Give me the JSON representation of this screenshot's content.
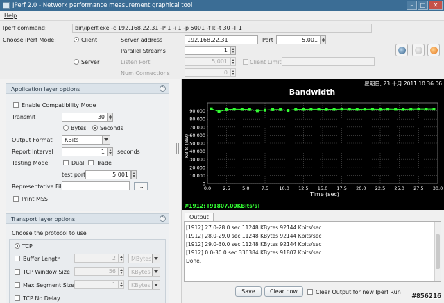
{
  "window": {
    "title": "JPerf 2.0 - Network performance measurement graphical tool"
  },
  "menu": {
    "help": "Help"
  },
  "command": {
    "label": "Iperf command:",
    "value": "bin/iperf.exe -c 192.168.22.31 -P 1 -i 1 -p 5001 -f k -t 30 -T 1"
  },
  "mode": {
    "label": "Choose iPerf Mode:",
    "client_label": "Client",
    "server_label": "Server",
    "server_address_label": "Server address",
    "server_address_value": "192.168.22.31",
    "port_label": "Port",
    "port_value": "5,001",
    "parallel_label": "Parallel Streams",
    "parallel_value": "1",
    "listen_port_label": "Listen Port",
    "listen_port_value": "5,001",
    "client_limit_label": "Client Limit",
    "num_conn_label": "Num Connections",
    "num_conn_value": "0"
  },
  "app_options": {
    "title": "Application layer options",
    "compat_label": "Enable Compatibility Mode",
    "transmit_label": "Transmit",
    "transmit_value": "30",
    "bytes_label": "Bytes",
    "seconds_label": "Seconds",
    "output_format_label": "Output Format",
    "output_format_value": "KBits",
    "report_interval_label": "Report Interval",
    "report_interval_value": "1",
    "seconds_unit": "seconds",
    "testing_mode_label": "Testing Mode",
    "dual_label": "Dual",
    "trade_label": "Trade",
    "test_port_label": "test port",
    "test_port_value": "5,001",
    "rep_file_label": "Representative File",
    "browse_label": "...",
    "print_mss_label": "Print MSS"
  },
  "transport": {
    "title": "Transport layer options",
    "choose_label": "Choose the protocol to use",
    "tcp_label": "TCP",
    "buffer_label": "Buffer Length",
    "buffer_value": "2",
    "buffer_unit": "MBytes",
    "window_label": "TCP Window Size",
    "window_value": "56",
    "window_unit": "KBytes",
    "mss_label": "Max Segment Size",
    "mss_value": "1",
    "mss_unit": "KBytes",
    "nodelay_label": "TCP No Delay"
  },
  "chart_data": {
    "type": "line",
    "title": "Bandwidth",
    "timestamp": "星期日, 23 十月 2011 10:36:06",
    "xlabel": "Time (sec)",
    "ylabel": "KBits (BW)",
    "xlim": [
      0,
      30
    ],
    "ylim": [
      0,
      100000
    ],
    "x_ticks": [
      "0.0",
      "2.5",
      "5.0",
      "7.5",
      "10.0",
      "12.5",
      "15.0",
      "17.5",
      "20.0",
      "22.5",
      "25.0",
      "27.5",
      "30.0"
    ],
    "y_ticks": [
      "0",
      "10,000",
      "20,000",
      "30,000",
      "40,000",
      "50,000",
      "60,000",
      "70,000",
      "80,000",
      "90,000"
    ],
    "grid": true,
    "series": [
      {
        "name": "#1912: [91807.00KBits/s]",
        "color": "#33ff33",
        "x": [
          0.5,
          1.5,
          2.5,
          3.5,
          4.5,
          5.5,
          6.5,
          7.5,
          8.5,
          9.5,
          10.5,
          11.5,
          12.5,
          13.5,
          14.5,
          15.5,
          16.5,
          17.5,
          18.5,
          19.5,
          20.5,
          21.5,
          22.5,
          23.5,
          24.5,
          25.5,
          26.5,
          27.5,
          28.5,
          29.5
        ],
        "y": [
          92500,
          89000,
          91500,
          92000,
          91800,
          91700,
          90200,
          90800,
          91500,
          91600,
          90500,
          91700,
          91800,
          91900,
          91900,
          91700,
          91800,
          92000,
          92000,
          91800,
          91900,
          92000,
          91800,
          92100,
          91900,
          91800,
          92000,
          92144,
          92144,
          92144
        ]
      }
    ],
    "legend": "bottom-left"
  },
  "output": {
    "tab_label": "Output",
    "lines": [
      "[1912] 27.0-28.0 sec  11248 KBytes  92144 Kbits/sec",
      "[1912] 28.0-29.0 sec  11248 KBytes  92144 Kbits/sec",
      "[1912] 29.0-30.0 sec  11248 KBytes  92144 Kbits/sec",
      "[1912]  0.0-30.0 sec  336384 KBytes  91807 Kbits/sec",
      "Done."
    ],
    "save_label": "Save",
    "clear_label": "Clear now",
    "clear_check_label": "Clear Output for new Iperf Run"
  },
  "watermark": "#856216"
}
